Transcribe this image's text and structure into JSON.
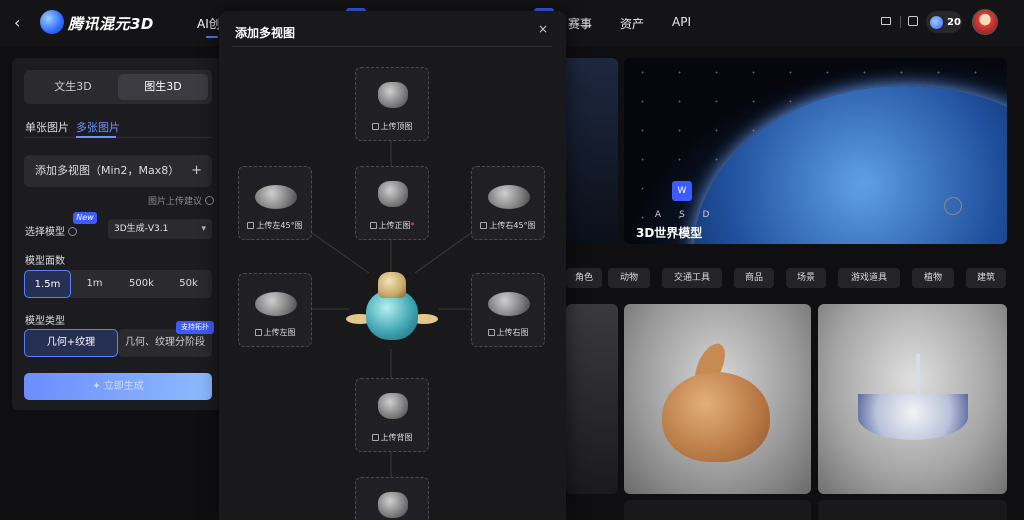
{
  "header": {
    "back_icon": "chevron-left-icon",
    "brand": "腾讯混元3D",
    "nav": [
      {
        "label": "AI创"
      },
      {
        "label": "赛事"
      },
      {
        "label": "资产"
      },
      {
        "label": "API"
      }
    ],
    "credits": "20",
    "icons": [
      "mail-icon",
      "gift-icon",
      "coin-icon",
      "avatar"
    ]
  },
  "left_panel": {
    "modes": [
      "文生3D",
      "图生3D"
    ],
    "active_mode": "图生3D",
    "subtabs": [
      "单张图片",
      "多张图片"
    ],
    "active_subtab": "多张图片",
    "add_views": "添加多视图（Min2，Max8）",
    "add_views_plus": "+",
    "upload_hint": "图片上传建议",
    "model_label": "选择模型",
    "new_badge": "New",
    "model_value": "3D生成-V3.1",
    "face_label": "模型面数",
    "face_options": [
      "1.5m",
      "1m",
      "500k",
      "50k"
    ],
    "active_face": "1.5m",
    "type_label": "模型类型",
    "support_badge": "支持拓扑",
    "type_options": [
      "几何+纹理",
      "几何、纹理分阶段"
    ],
    "generate": "✦ 立即生成"
  },
  "modal": {
    "title": "添加多视图",
    "close": "×",
    "slots": {
      "top": "上传顶图",
      "left45": "上传左45°图",
      "front": "上传正图",
      "front_required": "*",
      "right45": "上传右45°图",
      "left": "上传左图",
      "right": "上传右图",
      "back": "上传背图"
    }
  },
  "gallery": {
    "hero_title": "3D世界模型",
    "keys": [
      "W",
      "A",
      "S",
      "D"
    ],
    "categories": [
      "角色",
      "动物",
      "交通工具",
      "商品",
      "场景",
      "游戏道具",
      "植物",
      "建筑"
    ]
  },
  "colors": {
    "accent": "#4d7cff",
    "badge": "#3d5cff",
    "panel": "#1c1c20",
    "modal": "#19191c"
  }
}
